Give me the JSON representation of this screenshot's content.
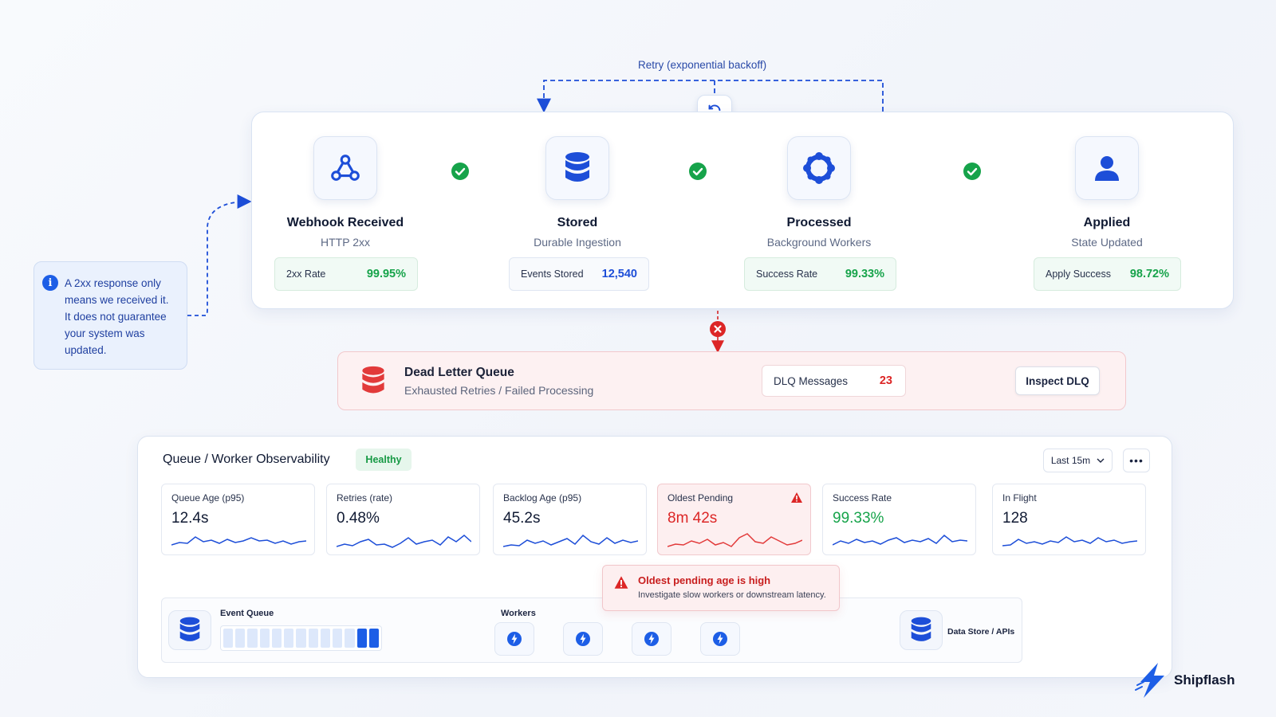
{
  "retry": {
    "label": "Retry (exponential backoff)",
    "icon": "refresh-icon"
  },
  "info_note": {
    "text": "A 2xx response only means we received it. It does not guarantee your system was updated.",
    "icon": "info-icon"
  },
  "stages": [
    {
      "title": "Webhook Received",
      "subtitle": "HTTP 2xx",
      "icon": "webhook-icon",
      "metric_label": "2xx Rate",
      "metric_value": "99.95%"
    },
    {
      "title": "Stored",
      "subtitle": "Durable Ingestion",
      "icon": "database-icon",
      "metric_label": "Events Stored",
      "metric_value": "12,540"
    },
    {
      "title": "Processed",
      "subtitle": "Background Workers",
      "icon": "worker-gear-icon",
      "metric_label": "Success Rate",
      "metric_value": "99.33%"
    },
    {
      "title": "Applied",
      "subtitle": "State Updated",
      "icon": "user-icon",
      "metric_label": "Apply Success",
      "metric_value": "98.72%"
    }
  ],
  "dlq": {
    "title": "Dead Letter Queue",
    "subtitle": "Exhausted Retries / Failed Processing",
    "metric_label": "DLQ Messages",
    "metric_value": "23",
    "button": "Inspect DLQ",
    "icon": "database-red-icon"
  },
  "observability": {
    "title": "Queue / Worker Observability",
    "status": "Healthy",
    "time_range": "Last 15m",
    "more": "•••",
    "kpis": [
      {
        "label": "Queue Age (p95)",
        "value": "12.4s"
      },
      {
        "label": "Retries (rate)",
        "value": "0.48%"
      },
      {
        "label": "Backlog Age (p95)",
        "value": "45.2s"
      },
      {
        "label": "Oldest Pending",
        "value": "8m 42s"
      },
      {
        "label": "Success Rate",
        "value": "99.33%"
      },
      {
        "label": "In Flight",
        "value": "128"
      }
    ],
    "alert": {
      "title": "Oldest pending age is high",
      "subtitle": "Investigate slow workers or downstream latency."
    },
    "flow": {
      "queue_label": "Event Queue",
      "workers_label": "Workers",
      "store_label": "Data Store / APIs"
    }
  },
  "colors": {
    "accent": "#1d4ed8",
    "success": "#16a34a",
    "danger": "#dc2626"
  },
  "brand": {
    "name": "Shipflash"
  }
}
